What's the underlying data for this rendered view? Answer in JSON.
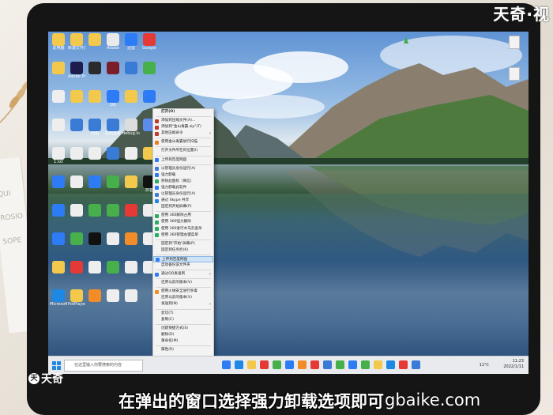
{
  "brand": {
    "top_logo": "天奇·视",
    "bottom_logo": "天奇",
    "watermark": "gbaike.com"
  },
  "subtitle": "在弹出的窗口选择强力卸载选项即可",
  "desktop": {
    "icons": [
      {
        "label": "此电脑",
        "color": "#f2c94c"
      },
      {
        "label": "新建文件夹",
        "color": "#f2c94c"
      },
      {
        "label": "",
        "color": "#f2c94c"
      },
      {
        "label": "Adobe",
        "color": "#eaeaea"
      },
      {
        "label": "迅雷",
        "color": "#2d7cf6"
      },
      {
        "label": "Google",
        "color": "#e53935"
      },
      {
        "label": "",
        "color": "#f2c94c"
      },
      {
        "label": "Adobe Premiere",
        "color": "#1f1b4d"
      },
      {
        "label": "",
        "color": "#2b2b2b"
      },
      {
        "label": "",
        "color": "#7b1e2a"
      },
      {
        "label": "",
        "color": "#3a7bd5"
      },
      {
        "label": "",
        "color": "#47b04b"
      },
      {
        "label": "",
        "color": "#eeeeee"
      },
      {
        "label": "",
        "color": "#f2c94c"
      },
      {
        "label": "",
        "color": "#f2c94c"
      },
      {
        "label": "QQ",
        "color": "#2d7cf6"
      },
      {
        "label": "",
        "color": "#f2c94c"
      },
      {
        "label": "",
        "color": "#2d7cf6"
      },
      {
        "label": "",
        "color": "#eeeeee"
      },
      {
        "label": "",
        "color": "#3a7bd5"
      },
      {
        "label": "网络",
        "color": "#3a7bd5"
      },
      {
        "label": "控制面板",
        "color": "#3a7bd5"
      },
      {
        "label": "debug.log",
        "color": "#dddddd"
      },
      {
        "label": "",
        "color": "#5b8def"
      },
      {
        "label": "1.txt",
        "color": "#eeeeee"
      },
      {
        "label": "",
        "color": "#eeeeee"
      },
      {
        "label": "",
        "color": "#eeeeee"
      },
      {
        "label": "",
        "color": "#3a7bd5"
      },
      {
        "label": "",
        "color": "#eeeeee"
      },
      {
        "label": "",
        "color": "#f2c94c"
      },
      {
        "label": "",
        "color": "#2d7cf6"
      },
      {
        "label": "",
        "color": "#eeeeee"
      },
      {
        "label": "",
        "color": "#2d7cf6"
      },
      {
        "label": "",
        "color": "#47b04b"
      },
      {
        "label": "",
        "color": "#f2c94c"
      },
      {
        "label": "抖音",
        "color": "#111111"
      },
      {
        "label": "",
        "color": "#2d7cf6"
      },
      {
        "label": "",
        "color": "#eeeeee"
      },
      {
        "label": "",
        "color": "#47b04b"
      },
      {
        "label": "",
        "color": "#47b04b"
      },
      {
        "label": "",
        "color": "#e53935"
      },
      {
        "label": "",
        "color": "#eeeeee"
      },
      {
        "label": "",
        "color": "#2d7cf6"
      },
      {
        "label": "",
        "color": "#47b04b"
      },
      {
        "label": "",
        "color": "#111111"
      },
      {
        "label": "",
        "color": "#eeeeee"
      },
      {
        "label": "",
        "color": "#f28c28"
      },
      {
        "label": "",
        "color": "#eeeeee"
      },
      {
        "label": "",
        "color": "#f2c94c"
      },
      {
        "label": "",
        "color": "#e53935"
      },
      {
        "label": "",
        "color": "#eeeeee"
      },
      {
        "label": "",
        "color": "#47b04b"
      },
      {
        "label": "",
        "color": "#eeeeee"
      },
      {
        "label": "",
        "color": "#eeeeee"
      },
      {
        "label": "Microsoft Edge",
        "color": "#1e88e5"
      },
      {
        "label": "PotPlayer 64 bit",
        "color": "#f2c94c"
      },
      {
        "label": "",
        "color": "#f28c28"
      },
      {
        "label": "",
        "color": "#eeeeee"
      },
      {
        "label": "",
        "color": "#eeeeee"
      }
    ],
    "right_icons": [
      {
        "label": ""
      },
      {
        "label": ""
      }
    ]
  },
  "context_menu": {
    "items": [
      {
        "label": "打开(O)",
        "icon_color": "",
        "bold": true
      },
      {
        "sep": true
      },
      {
        "label": "添加到压缩文件(A)...",
        "icon_color": "#c0392b"
      },
      {
        "label": "添加到\"金山毒霸.zip\"(T)",
        "icon_color": "#c0392b"
      },
      {
        "label": "其他压缩命令",
        "icon_color": "#c0392b",
        "arrow": true
      },
      {
        "sep": true
      },
      {
        "label": "使用金山毒霸进行扫描",
        "icon_color": "#e67e22"
      },
      {
        "sep": true
      },
      {
        "label": "打开文件所在的位置(I)",
        "icon_color": ""
      },
      {
        "sep": true
      },
      {
        "label": "上传到百度网盘",
        "icon_color": "#2d7cf6"
      },
      {
        "sep": true
      },
      {
        "label": "以管理员身份运行(A)",
        "icon_color": "#3a7bd5"
      },
      {
        "label": "强力卸载",
        "icon_color": "#2d7cf6"
      },
      {
        "label": "移除此图标（微信）",
        "icon_color": "#27ae60"
      },
      {
        "label": "强力卸载此软件",
        "icon_color": "#2d7cf6"
      },
      {
        "label": "以管理员身份运行(A)",
        "icon_color": "#3a7bd5"
      },
      {
        "label": "通过 Skype 共享",
        "icon_color": "#1e88e5"
      },
      {
        "label": "固定到开始屏幕(P)",
        "icon_color": ""
      },
      {
        "sep": true
      },
      {
        "label": "使用 360解除占用",
        "icon_color": "#27ae60"
      },
      {
        "label": "使用 360强力删除",
        "icon_color": "#27ae60"
      },
      {
        "label": "使用 360进行木马云查杀",
        "icon_color": "#27ae60"
      },
      {
        "label": "使用 360管理右键菜单",
        "icon_color": "#27ae60"
      },
      {
        "sep": true
      },
      {
        "label": "固定到\"开始\"屏幕(P)",
        "icon_color": ""
      },
      {
        "label": "固定到任务栏(K)",
        "icon_color": ""
      },
      {
        "sep": true
      },
      {
        "label": "上传到百度网盘",
        "icon_color": "#2d7cf6",
        "highlight": true
      },
      {
        "label": "自动备份该文件夹",
        "icon_color": ""
      },
      {
        "sep": true
      },
      {
        "label": "通过QQ发送到",
        "icon_color": "#2d7cf6",
        "arrow": true
      },
      {
        "sep": true
      },
      {
        "label": "还原以前的版本(V)",
        "icon_color": ""
      },
      {
        "sep": true
      },
      {
        "label": "使用火绒安全进行杀毒",
        "icon_color": "#f28c28"
      },
      {
        "label": "还原以前的版本(V)",
        "icon_color": ""
      },
      {
        "label": "发送到(N)",
        "icon_color": "",
        "arrow": true
      },
      {
        "sep": true
      },
      {
        "label": "剪切(T)",
        "icon_color": ""
      },
      {
        "label": "复制(C)",
        "icon_color": ""
      },
      {
        "sep": true
      },
      {
        "label": "创建快捷方式(S)",
        "icon_color": ""
      },
      {
        "label": "删除(D)",
        "icon_color": ""
      },
      {
        "label": "重命名(M)",
        "icon_color": ""
      },
      {
        "sep": true
      },
      {
        "label": "属性(R)",
        "icon_color": ""
      }
    ]
  },
  "taskbar": {
    "search_placeholder": "在这里输入你要搜索的内容",
    "apps": [
      "#2d7cf6",
      "#1e88e5",
      "#f2c94c",
      "#e53935",
      "#47b04b",
      "#2d7cf6",
      "#f28c28",
      "#e53935",
      "#3a7bd5",
      "#47b04b",
      "#2d7cf6",
      "#47b04b",
      "#f2c94c",
      "#1e88e5",
      "#e53935",
      "#3a7bd5"
    ],
    "weather": "11°C",
    "time": "11:23",
    "date": "2022/1/11"
  }
}
